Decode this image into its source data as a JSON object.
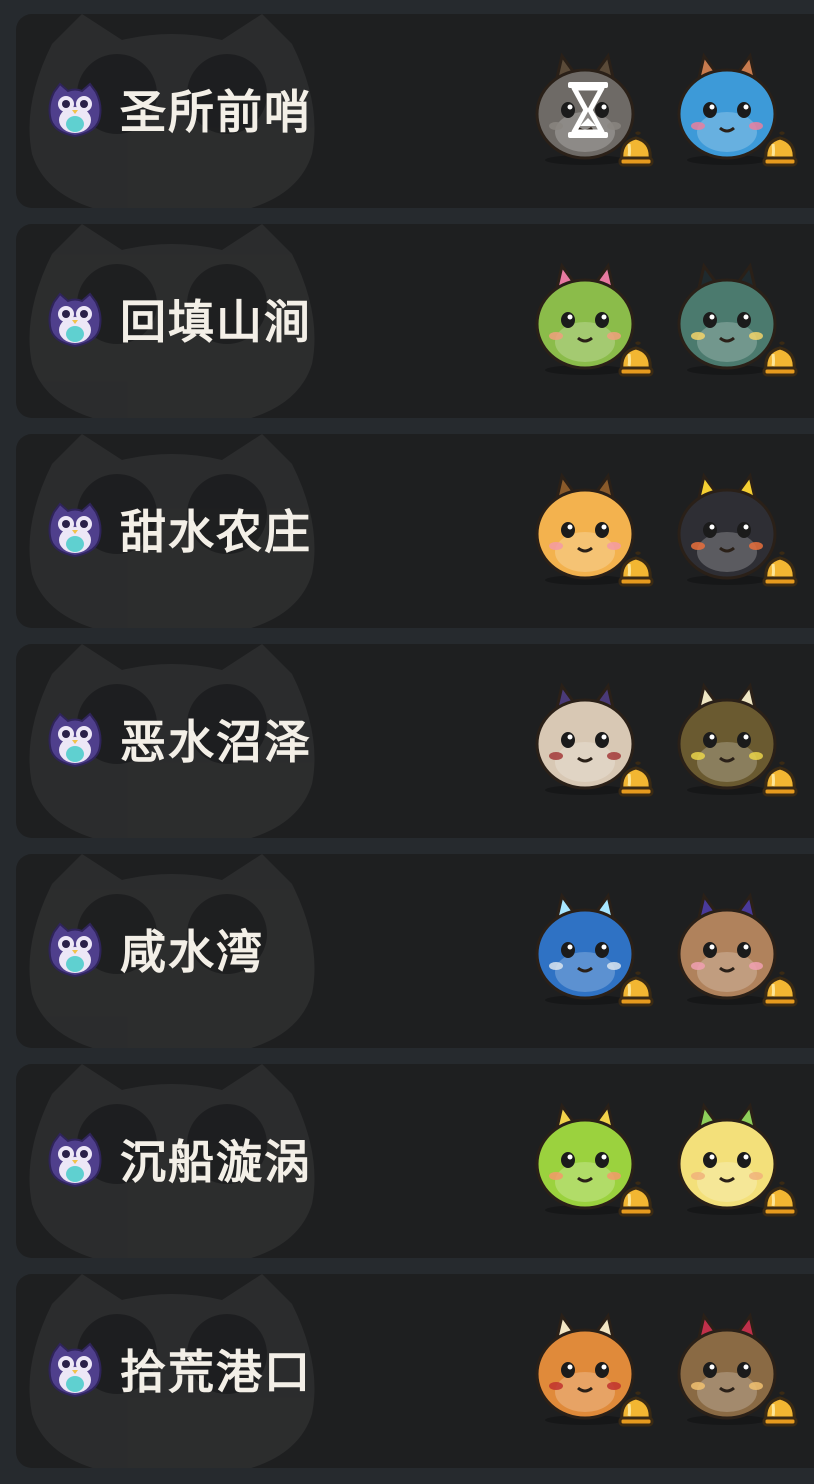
{
  "zones": [
    {
      "name": "圣所前哨",
      "has_timer": true,
      "pets": [
        {
          "icon": "grey-mole-pet-icon",
          "body": "#6e6a66",
          "accent": "#5a4a38",
          "cheek": "#8a8580"
        },
        {
          "icon": "blue-hedgehog-pet-icon",
          "body": "#3d9ad8",
          "accent": "#c87b4e",
          "cheek": "#e97f9f"
        }
      ]
    },
    {
      "name": "回填山涧",
      "has_timer": false,
      "pets": [
        {
          "icon": "green-frog-pet-icon",
          "body": "#8bbc4a",
          "accent": "#e77aa0",
          "cheek": "#f0a07c"
        },
        {
          "icon": "robot-cat-pet-icon",
          "body": "#4b7a6e",
          "accent": "#1f2a2e",
          "cheek": "#f2d36a"
        }
      ]
    },
    {
      "name": "甜水农庄",
      "has_timer": false,
      "pets": [
        {
          "icon": "orange-cat-pet-icon",
          "body": "#f3b24e",
          "accent": "#8a5a2a",
          "cheek": "#f39aa5"
        },
        {
          "icon": "black-duck-pet-icon",
          "body": "#2e2e34",
          "accent": "#f5cf32",
          "cheek": "#e86e3c"
        }
      ]
    },
    {
      "name": "恶水沼泽",
      "has_timer": false,
      "pets": [
        {
          "icon": "rabbit-pet-icon",
          "body": "#d8c8b4",
          "accent": "#4a3a78",
          "cheek": "#a33a3a"
        },
        {
          "icon": "stick-owl-pet-icon",
          "body": "#6a5a30",
          "accent": "#efe6c3",
          "cheek": "#e9d44a"
        }
      ]
    },
    {
      "name": "咸水湾",
      "has_timer": false,
      "pets": [
        {
          "icon": "ice-whale-pet-icon",
          "body": "#2f72c4",
          "accent": "#a8e6ff",
          "cheek": "#d9e4ef"
        },
        {
          "icon": "purple-fish-pet-icon",
          "body": "#b0825c",
          "accent": "#4a3a9a",
          "cheek": "#f0a0b0"
        }
      ]
    },
    {
      "name": "沉船漩涡",
      "has_timer": false,
      "pets": [
        {
          "icon": "lime-turtle-pet-icon",
          "body": "#9bd23e",
          "accent": "#f2d24a",
          "cheek": "#f39a6a"
        },
        {
          "icon": "sprout-pet-icon",
          "body": "#f3e07a",
          "accent": "#8fcf5a",
          "cheek": "#f0b27a"
        }
      ]
    },
    {
      "name": "拾荒港口",
      "has_timer": false,
      "pets": [
        {
          "icon": "straw-hat-pet-icon",
          "body": "#e08a3a",
          "accent": "#f2e6c4",
          "cheek": "#c0312e"
        },
        {
          "icon": "horned-lizard-pet-icon",
          "body": "#8a6a44",
          "accent": "#c0304a",
          "cheek": "#f0c070"
        }
      ]
    }
  ]
}
